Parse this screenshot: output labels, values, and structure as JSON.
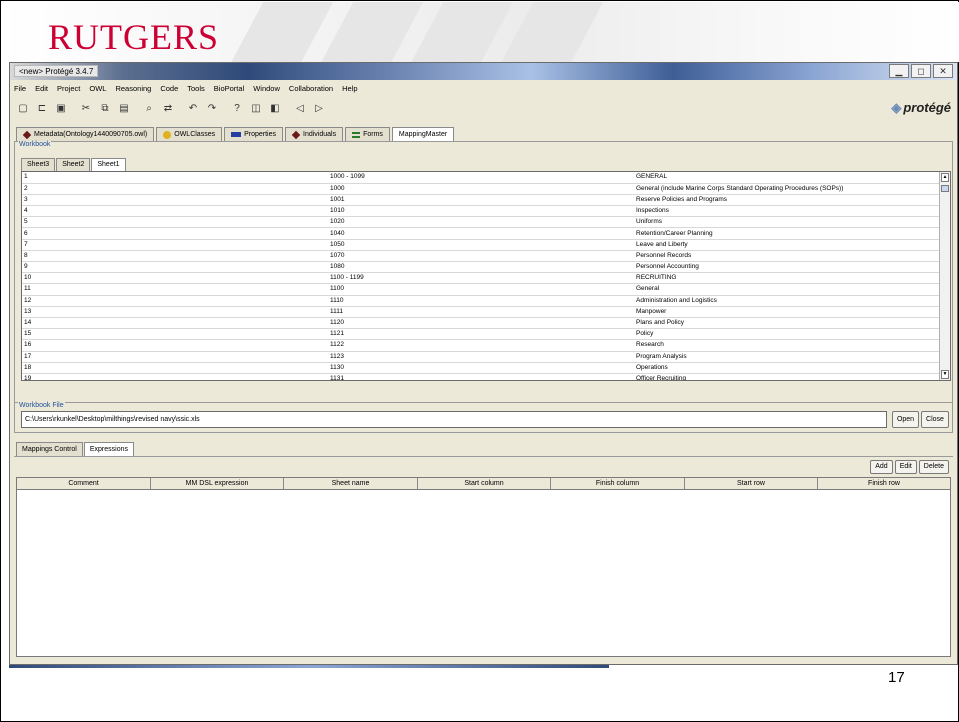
{
  "banner": {
    "logo": "RUTGERS"
  },
  "window": {
    "title": "<new> Protégé 3.4.7",
    "controls": [
      "▁",
      "◻",
      "✕"
    ]
  },
  "menu": [
    "File",
    "Edit",
    "Project",
    "OWL",
    "Reasoning",
    "Code",
    "Tools",
    "BioPortal",
    "Window",
    "Collaboration",
    "Help"
  ],
  "brand": "protégé",
  "tabs": [
    {
      "label": "Metadata(Ontology1440090705.owl)",
      "icon": "diamond-icon"
    },
    {
      "label": "OWLClasses",
      "icon": "circle-icon"
    },
    {
      "label": "Properties",
      "icon": "rect-icon"
    },
    {
      "label": "Individuals",
      "icon": "diamond-icon"
    },
    {
      "label": "Forms",
      "icon": "forms-icon"
    },
    {
      "label": "MappingMaster",
      "icon": ""
    }
  ],
  "workbook": {
    "label": "Workbook",
    "sheets": [
      "Sheet3",
      "Sheet2",
      "Sheet1"
    ],
    "active_sheet": "Sheet1",
    "rows": [
      [
        "1",
        "1000 - 1099",
        "GENERAL"
      ],
      [
        "2",
        "1000",
        "General (include Marine Corps Standard Operating Procedures (SOPs))"
      ],
      [
        "3",
        "1001",
        "Reserve Policies and Programs"
      ],
      [
        "4",
        "1010",
        "Inspections"
      ],
      [
        "5",
        "1020",
        "Uniforms"
      ],
      [
        "6",
        "1040",
        "Retention/Career Planning"
      ],
      [
        "7",
        "1050",
        "Leave and Liberty"
      ],
      [
        "8",
        "1070",
        "Personnel Records"
      ],
      [
        "9",
        "1080",
        "Personnel Accounting"
      ],
      [
        "10",
        "1100 - 1199",
        "RECRUITING"
      ],
      [
        "11",
        "1100",
        "General"
      ],
      [
        "12",
        "1110",
        "Administration and Logistics"
      ],
      [
        "13",
        "1111",
        "Manpower"
      ],
      [
        "14",
        "1120",
        "Plans and Policy"
      ],
      [
        "15",
        "1121",
        "Policy"
      ],
      [
        "16",
        "1122",
        "Research"
      ],
      [
        "17",
        "1123",
        "Program Analysis"
      ],
      [
        "18",
        "1130",
        "Operations"
      ],
      [
        "19",
        "1131",
        "Officer Recruiting"
      ]
    ]
  },
  "workbook_file": {
    "label": "Workbook File",
    "path": "C:\\Users\\rkunkel\\Desktop\\milthings\\revised navy\\ssic.xls",
    "open_label": "Open",
    "close_label": "Close"
  },
  "lower": {
    "tabs": [
      "Mappings Control",
      "Expressions"
    ],
    "active_tab": "Expressions",
    "actions": [
      "Add",
      "Edit",
      "Delete"
    ],
    "columns": [
      "Comment",
      "MM DSL expression",
      "Sheet name",
      "Start column",
      "Finish column",
      "Start row",
      "Finish row"
    ]
  },
  "page_number": "17",
  "colors": {
    "rutgers_red": "#cc0033",
    "panel": "#ece9d8",
    "label_blue": "#1f4f9a"
  }
}
